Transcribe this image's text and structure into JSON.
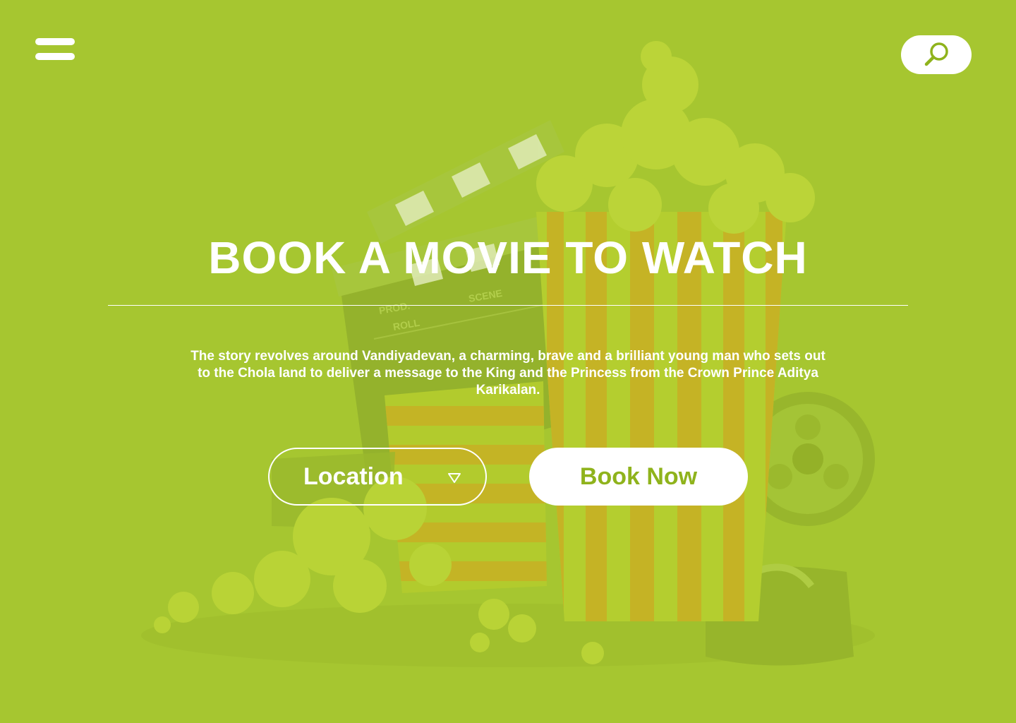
{
  "colors": {
    "background": "#a6c730",
    "accent_text": "#8fb31c",
    "foreground": "#ffffff"
  },
  "header": {
    "menu_icon": "hamburger-menu-icon",
    "search_icon": "search-icon"
  },
  "hero": {
    "title": "BOOK A MOVIE TO WATCH",
    "description": "The story revolves around Vandiyadevan, a charming, brave and a brilliant young man who sets out to the Chola land to deliver a message to the King and the Princess from the Crown Prince Aditya Karikalan.",
    "illustration": {
      "clapperboard_prod": "PROD.",
      "clapperboard_roll": "ROLL",
      "clapperboard_scene": "SCENE"
    }
  },
  "actions": {
    "location_label": "Location",
    "location_icon": "triangle-down-icon",
    "book_label": "Book Now"
  }
}
